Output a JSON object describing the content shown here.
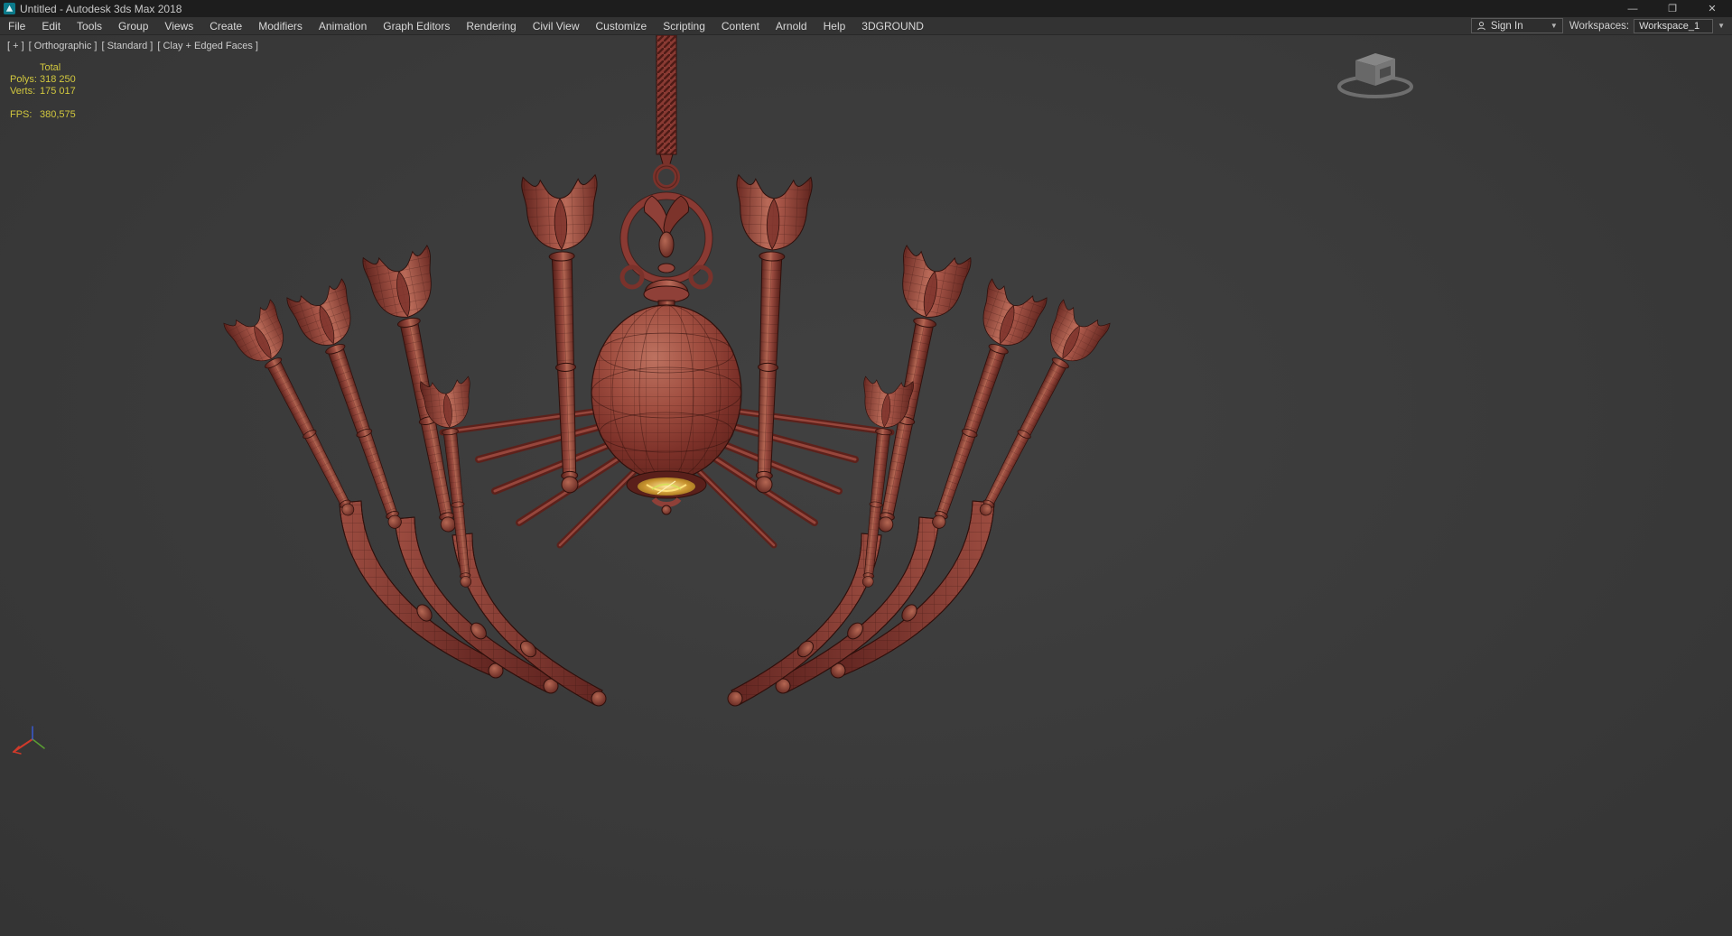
{
  "window": {
    "icon": "3ds-max-logo",
    "title": "Untitled - Autodesk 3ds Max 2018",
    "controls": {
      "minimize": "—",
      "maximize": "❐",
      "close": "✕"
    }
  },
  "menubar": {
    "items": [
      "File",
      "Edit",
      "Tools",
      "Group",
      "Views",
      "Create",
      "Modifiers",
      "Animation",
      "Graph Editors",
      "Rendering",
      "Civil View",
      "Customize",
      "Scripting",
      "Content",
      "Arnold",
      "Help",
      "3DGROUND"
    ],
    "sign_in": {
      "icon": "user-icon",
      "label": "Sign In",
      "caret": "▼"
    },
    "workspaces": {
      "label": "Workspaces:",
      "value": "Workspace_1",
      "caret": "▼"
    }
  },
  "viewport": {
    "label_segments": [
      "[ + ]",
      "[ Orthographic ]",
      "[ Standard ]",
      "[ Clay + Edged Faces ]"
    ],
    "statistics": {
      "header": "Total",
      "rows": [
        {
          "label": "Polys:",
          "value": "318 250"
        },
        {
          "label": "Verts:",
          "value": "175 017"
        }
      ],
      "fps_label": "FPS:",
      "fps_value": "380,575"
    },
    "scene": {
      "object": "chandelier-wireframe-model",
      "shading_mode": "Clay + Edged Faces",
      "colors": {
        "clay": "#8f4038",
        "edges": "#2f100c",
        "glow": "#e8c23c",
        "background": "#3b3b3b"
      }
    },
    "viewcube": {
      "name": "view-cube"
    },
    "axis_gizmo": {
      "x_color": "#d03a2a",
      "y_color": "#5a9e32",
      "z_color": "#3a5ad0"
    }
  }
}
